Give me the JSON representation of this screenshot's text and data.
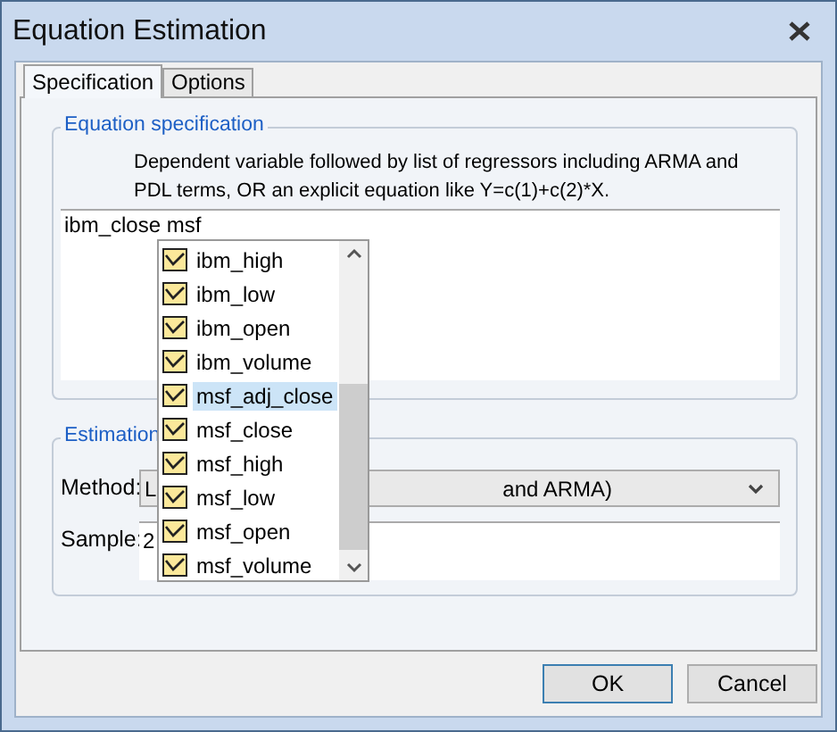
{
  "window": {
    "title": "Equation Estimation"
  },
  "tabs": [
    {
      "label": "Specification",
      "selected": true
    },
    {
      "label": "Options",
      "selected": false
    }
  ],
  "equation_specification": {
    "title": "Equation specification",
    "description": "Dependent variable followed by list of regressors including ARMA and PDL terms, OR an explicit equation like Y=c(1)+c(2)*X.",
    "value": "ibm_close msf"
  },
  "estimation": {
    "title": "Estimation",
    "method_label": "Method:",
    "method_value_left": "L",
    "method_value_right": "and ARMA)",
    "sample_label": "Sample:",
    "sample_value": "2"
  },
  "autocomplete": {
    "items": [
      {
        "label": "ibm_high",
        "selected": false
      },
      {
        "label": "ibm_low",
        "selected": false
      },
      {
        "label": "ibm_open",
        "selected": false
      },
      {
        "label": "ibm_volume",
        "selected": false
      },
      {
        "label": "msf_adj_close",
        "selected": true
      },
      {
        "label": "msf_close",
        "selected": false
      },
      {
        "label": "msf_high",
        "selected": false
      },
      {
        "label": "msf_low",
        "selected": false
      },
      {
        "label": "msf_open",
        "selected": false
      },
      {
        "label": "msf_volume",
        "selected": false
      }
    ]
  },
  "buttons": [
    {
      "label": "OK",
      "default": true
    },
    {
      "label": "Cancel",
      "default": false
    }
  ]
}
